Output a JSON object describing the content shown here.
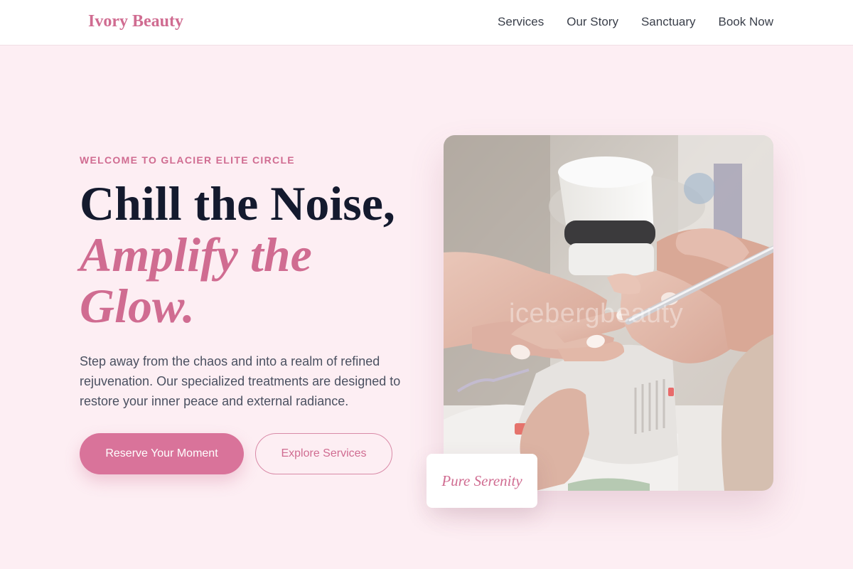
{
  "header": {
    "brand": "Ivory Beauty",
    "nav": [
      "Services",
      "Our Story",
      "Sanctuary",
      "Book Now"
    ]
  },
  "hero": {
    "eyebrow": "WELCOME TO GLACIER ELITE CIRCLE",
    "headline_line1": "Chill the Noise,",
    "headline_line2": "Amplify the",
    "headline_line3": "Glow.",
    "description": "Step away from the chaos and into a realm of refined rejuvenation. Our specialized treatments are designed to restore your inner peace and external radiance.",
    "primary_cta": "Reserve Your Moment",
    "secondary_cta": "Explore Services",
    "image_watermark": "icebergbeauty",
    "badge_text": "Pure Serenity"
  },
  "colors": {
    "accent": "#d06c91",
    "background": "#fdeef3",
    "heading": "#141a2e"
  }
}
